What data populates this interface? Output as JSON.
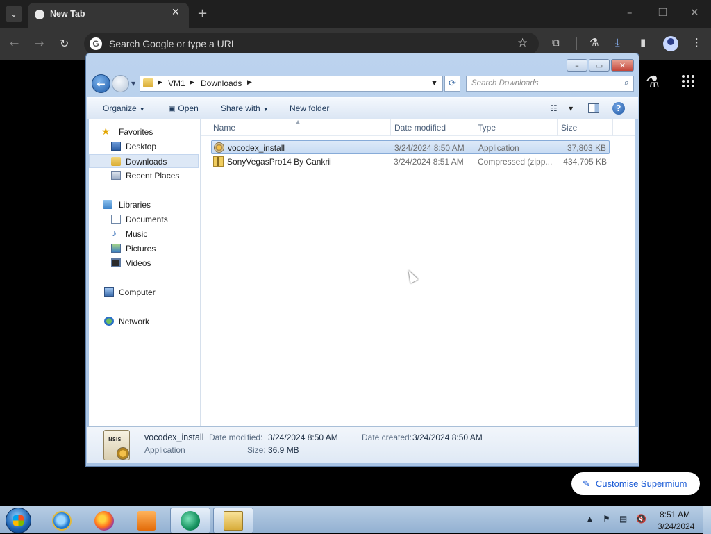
{
  "browser": {
    "tab_title": "New Tab",
    "tab_close": "✕",
    "new_tab": "+",
    "omnibox_placeholder": "Search Google or type a URL",
    "google_letter": "G",
    "customise_label": "Customise Supermium",
    "customise_icon": "✎"
  },
  "explorer": {
    "caption_buttons": {
      "minimize": "–",
      "maximize": "▭",
      "close": "✕"
    },
    "breadcrumb": [
      "VM1",
      "Downloads"
    ],
    "search_placeholder": "Search Downloads",
    "toolbar": {
      "organize": "Organize",
      "open": "Open",
      "share_with": "Share with",
      "new_folder": "New folder"
    },
    "nav": {
      "favorites": "Favorites",
      "desktop": "Desktop",
      "downloads": "Downloads",
      "recent_places": "Recent Places",
      "libraries": "Libraries",
      "documents": "Documents",
      "music": "Music",
      "pictures": "Pictures",
      "videos": "Videos",
      "computer": "Computer",
      "network": "Network"
    },
    "columns": {
      "name": "Name",
      "date_modified": "Date modified",
      "type": "Type",
      "size": "Size"
    },
    "files": [
      {
        "name": "vocodex_install",
        "date_modified": "3/24/2024 8:50 AM",
        "type": "Application",
        "size": "37,803 KB",
        "icon": "installer-icon"
      },
      {
        "name": "SonyVegasPro14 By Cankrii",
        "date_modified": "3/24/2024 8:51 AM",
        "type": "Compressed (zipp...",
        "size": "434,705 KB",
        "icon": "zip-folder-icon"
      }
    ],
    "details": {
      "name": "vocodex_install",
      "type": "Application",
      "date_modified_label": "Date modified:",
      "date_modified": "3/24/2024 8:50 AM",
      "size_label": "Size:",
      "size": "36.9 MB",
      "date_created_label": "Date created:",
      "date_created": "3/24/2024 8:50 AM",
      "icon_text": "NSIS"
    }
  },
  "taskbar": {
    "time": "8:51 AM",
    "date": "3/24/2024"
  }
}
